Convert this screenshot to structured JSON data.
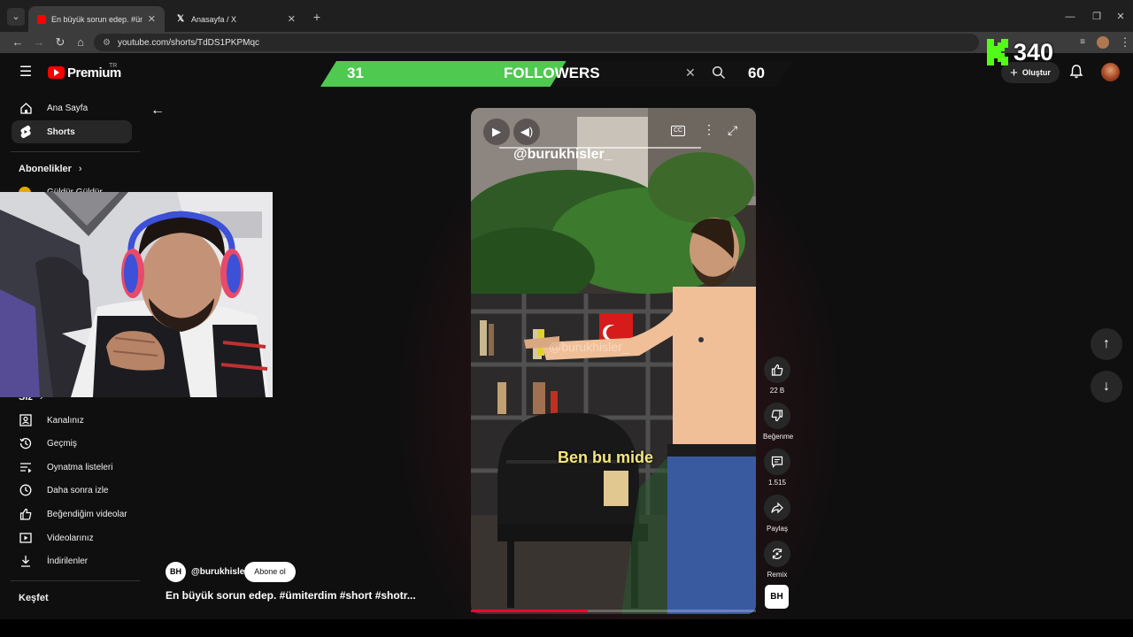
{
  "browser": {
    "tabs": [
      {
        "title": "En büyük sorun edep. #ümiterdi",
        "active": true,
        "favicon": "youtube-favicon",
        "color": "#ff0000"
      },
      {
        "title": "Anasayfa / X",
        "active": false,
        "favicon": "x-favicon",
        "color": "#ffffff"
      }
    ],
    "url": "youtube.com/shorts/TdDS1PKPMqc",
    "new_tab": "+",
    "window_controls": [
      "minimize-icon",
      "restore-icon",
      "close-icon"
    ]
  },
  "header": {
    "logo_text": "Premium",
    "logo_region": "TR",
    "create_label": "Oluştur",
    "icons": [
      "menu-icon",
      "bell-icon",
      "avatar"
    ]
  },
  "overlay": {
    "left_count": "31",
    "label": "FOLLOWERS",
    "right_count": "60",
    "progress": 0.52,
    "kick_count": "340",
    "kick_color": "#53fc18"
  },
  "sidebar": {
    "main": [
      {
        "label": "Ana Sayfa",
        "icon": "home-icon",
        "active": false
      },
      {
        "label": "Shorts",
        "icon": "shorts-icon",
        "active": true
      }
    ],
    "subs_heading": "Abonelikler",
    "subs_item": "Güldür Güldür",
    "you_heading": "Siz",
    "you_items": [
      {
        "label": "Kanalınız",
        "icon": "channel-icon"
      },
      {
        "label": "Geçmiş",
        "icon": "history-icon"
      },
      {
        "label": "Oynatma listeleri",
        "icon": "playlists-icon"
      },
      {
        "label": "Daha sonra izle",
        "icon": "watch-later-icon"
      },
      {
        "label": "Beğendiğim videolar",
        "icon": "liked-icon"
      },
      {
        "label": "Videolarınız",
        "icon": "your-videos-icon"
      },
      {
        "label": "İndirilenler",
        "icon": "download-icon"
      }
    ],
    "explore_heading": "Keşfet"
  },
  "video": {
    "watermark": "@burukhisler_",
    "caption": "Ben bu mide",
    "progress": 0.41,
    "flag_color": "#d71a1a"
  },
  "actions": {
    "like_count": "22 B",
    "dislike_label": "Beğenme",
    "comment_count": "1.515",
    "share_label": "Paylaş",
    "remix_label": "Remix"
  },
  "channel": {
    "handle": "@burukhisler",
    "avatar_text": "BH",
    "subscribe_label": "Abone ol",
    "title": "En büyük sorun edep. #ümiterdim #short #shotr..."
  }
}
